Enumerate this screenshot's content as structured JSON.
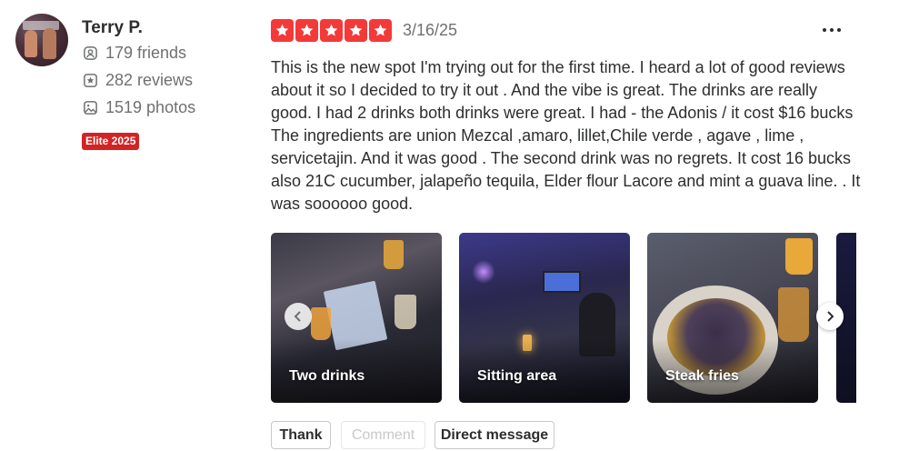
{
  "user": {
    "name": "Terry P.",
    "friends": "179 friends",
    "reviews": "282 reviews",
    "photos": "1519 photos",
    "elite_badge": "Elite 2025"
  },
  "review": {
    "rating": 5,
    "rating_max": 5,
    "date": "3/16/25",
    "text": "This is the new spot I'm trying out for the first time. I heard a lot of good reviews about it so I decided to try it out . And the vibe is great. The drinks are really good. I had 2 drinks both drinks were great. I had - the Adonis / it cost $16 bucks The ingredients are union Mezcal ,amaro, lillet,Chile verde , agave , lime , servicetajin. And it was good . The second drink was no regrets. It cost 16 bucks also 21C cucumber, jalapeño tequila, Elder flour Lacore and mint a guava line. . It was soooooo good."
  },
  "photos": [
    {
      "caption": "Two drinks"
    },
    {
      "caption": "Sitting area"
    },
    {
      "caption": "Steak fries"
    },
    {
      "caption": ""
    }
  ],
  "actions": {
    "thank": "Thank",
    "comment": "Comment",
    "direct_message": "Direct message"
  },
  "colors": {
    "star_red": "#f43939",
    "elite_red": "#d32323",
    "muted_text": "#6e7072",
    "disabled_text": "#c8c9ca"
  },
  "icons": {
    "friends": "friends-icon",
    "reviews": "review-star-icon",
    "photos": "photo-icon",
    "more": "more-options-icon",
    "prev": "chevron-left-icon",
    "next": "chevron-right-icon"
  }
}
